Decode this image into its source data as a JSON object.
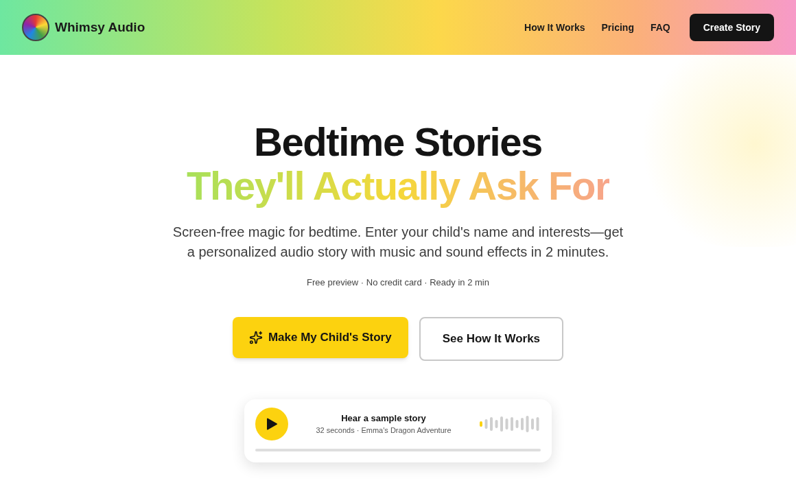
{
  "header": {
    "brand": "Whimsy Audio",
    "nav": [
      "How It Works",
      "Pricing",
      "FAQ"
    ],
    "cta": "Create Story"
  },
  "hero": {
    "title_line_1": "Bedtime Stories",
    "title_line_2": "They'll Actually Ask For",
    "subtitle": "Screen-free magic for bedtime. Enter your child's name and interests—get a personalized audio story with music and sound effects in 2 minutes.",
    "perks": "Free preview · No credit card · Ready in 2 min",
    "buttons": [
      {
        "kind": "primary",
        "label": "Make My Child's Story"
      },
      {
        "kind": "secondary",
        "label": "See How It Works"
      }
    ]
  },
  "player": {
    "title": "Hear a sample story",
    "meta": "32 seconds · Emma's Dragon Adventure",
    "level": 0
  }
}
